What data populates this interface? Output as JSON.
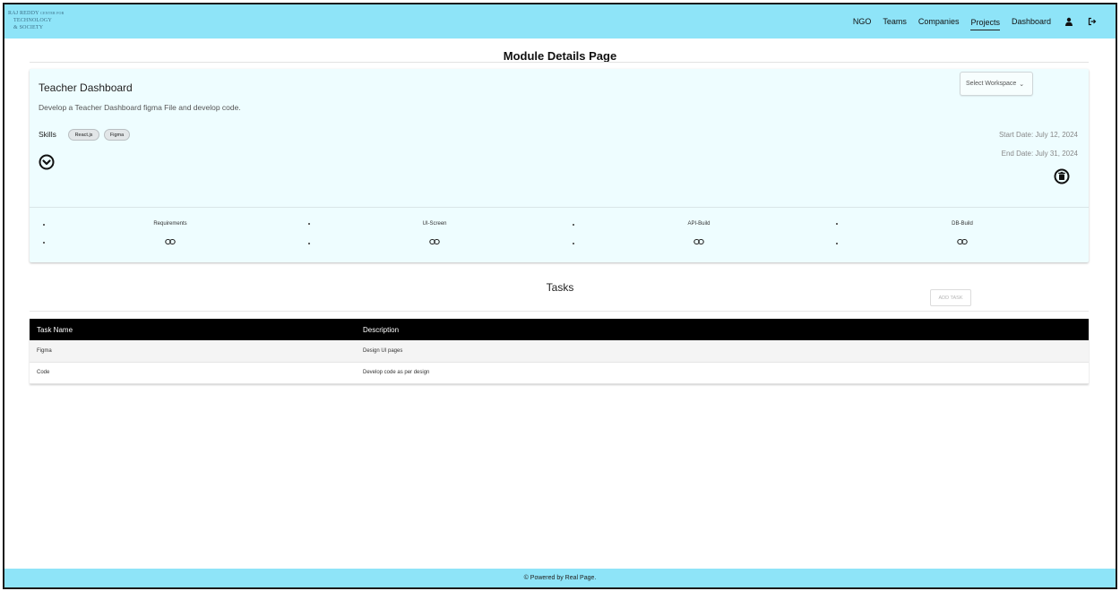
{
  "brand": {
    "line1": "Raj Reddy",
    "line1_small": "Center for",
    "line2": "Technology",
    "line3": "& Society"
  },
  "nav": {
    "items": [
      {
        "label": "NGO"
      },
      {
        "label": "Teams"
      },
      {
        "label": "Companies"
      },
      {
        "label": "Projects"
      },
      {
        "label": "Dashboard"
      }
    ],
    "active": "Projects",
    "icons": [
      "user-icon",
      "logout-icon"
    ]
  },
  "page": {
    "title": "Module Details Page"
  },
  "module": {
    "title": "Teacher Dashboard",
    "description": "Develop a Teacher Dashboard figma File and develop code.",
    "workspace_select": "Select Workspace",
    "skills_label": "Skills",
    "skills": [
      "React.js",
      "Figma"
    ],
    "start_date": "Start Date: July 12, 2024",
    "end_date": "End Date: July 31, 2024",
    "phases": [
      {
        "label": "Requirements"
      },
      {
        "label": "UI-Screen"
      },
      {
        "label": "API-Build"
      },
      {
        "label": "DB-Build"
      }
    ]
  },
  "tasks": {
    "title": "Tasks",
    "add_button": "ADD TASK",
    "columns": [
      "Task Name",
      "Description"
    ],
    "rows": [
      {
        "name": "Figma",
        "description": "Design UI pages"
      },
      {
        "name": "Code",
        "description": "Develop code as per design"
      }
    ]
  },
  "footer": {
    "text": "© Powered by Real Page."
  },
  "colors": {
    "nav_bg": "#8ee4f8",
    "card_bg": "#eefdff",
    "table_header_bg": "#000000"
  }
}
